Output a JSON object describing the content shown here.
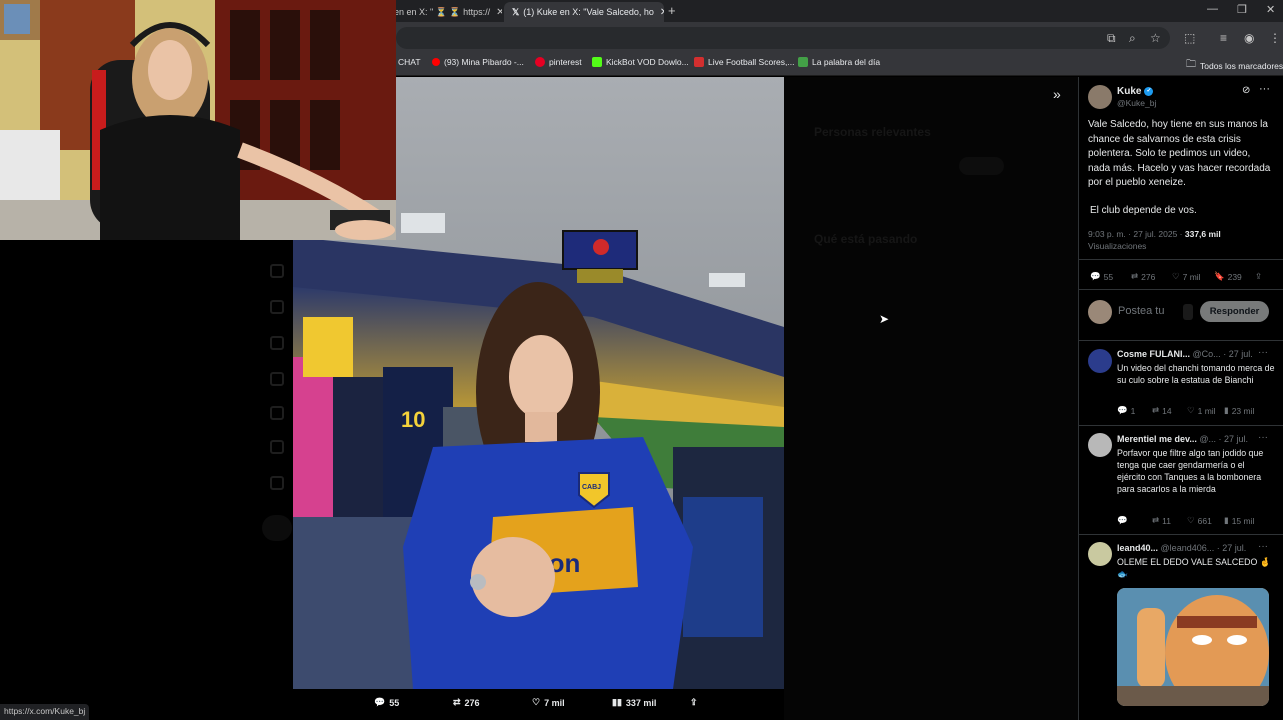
{
  "browser": {
    "tabs": [
      {
        "label": "en en X: \" ⏳ ⏳ https://",
        "active": false
      },
      {
        "label": "(1) Kuke en X: \"Vale Salcedo, ho",
        "active": true
      }
    ],
    "new_tab": "+",
    "window_controls": {
      "minimize": "—",
      "maximize": "❐",
      "close": "✕"
    },
    "bookmarks": [
      {
        "label": "CHAT",
        "color": "#c2185b"
      },
      {
        "label": "(93) Mina Pibardo -...",
        "color": "#ff0000"
      },
      {
        "label": "pinterest",
        "color": "#e60023"
      },
      {
        "label": "KickBot VOD Dowlo...",
        "color": "#53fc18"
      },
      {
        "label": "Live Football Scores,...",
        "color": "#d32f2f"
      },
      {
        "label": "La palabra del día",
        "color": "#43a047"
      }
    ],
    "all_bookmarks": "Todos los marcadores",
    "status_url": "https://x.com/Kuke_bj"
  },
  "media_actions": {
    "replies": "55",
    "reposts": "276",
    "likes": "7 mil",
    "views": "337 mil"
  },
  "tweet": {
    "author": "Kuke",
    "handle": "@Kuke_bj",
    "text_1": "Vale Salcedo, hoy tiene en sus manos la chance de salvarnos de esta crisis polentera. Solo te pedimos un video, nada más. Hacelo y vas hacer recordada por el pueblo xeneize.",
    "text_2": "El club depende de vos.",
    "time": "9:03 p. m. · 27 jul. 2025 · ",
    "views_count": "337,6 mil",
    "views_label": "Visualizaciones",
    "stats": {
      "replies": "55",
      "reposts": "276",
      "likes": "7 mil",
      "bookmarks": "239"
    },
    "reply_placeholder": "Postea tu",
    "reply_button": "Responder",
    "verified_color": "#1d9bf0"
  },
  "replies": [
    {
      "name": "Cosme FULANI...",
      "handle": "@Co...",
      "date": "· 27 jul.",
      "text": "Un video del chanchi tomando merca de su culo sobre la estatua de Bianchi",
      "replies": "1",
      "reposts": "14",
      "likes": "1 mil",
      "views": "23 mil"
    },
    {
      "name": "Merentiel me dev...",
      "handle": "@...",
      "date": "· 27 jul.",
      "text": "Porfavor que filtre algo tan jodido que tenga que caer gendarmería o el ejército con Tanques a la bombonera para sacarlos a la mierda",
      "replies": "",
      "reposts": "11",
      "likes": "661",
      "views": "15 mil"
    },
    {
      "name": "leand40...",
      "handle": "@leand406...",
      "date": "· 27 jul.",
      "text": "OLEME EL DEDO VALE SALCEDO 🤞🐟",
      "replies": "",
      "reposts": "",
      "likes": "",
      "views": ""
    }
  ],
  "background_panel": {
    "relevant": "Personas relevantes",
    "whats_happening": "Qué está pasando",
    "show_more": "Mostrar"
  },
  "shirt_text": "elsson",
  "badge_text": "CABJ",
  "jersey_number": "10"
}
